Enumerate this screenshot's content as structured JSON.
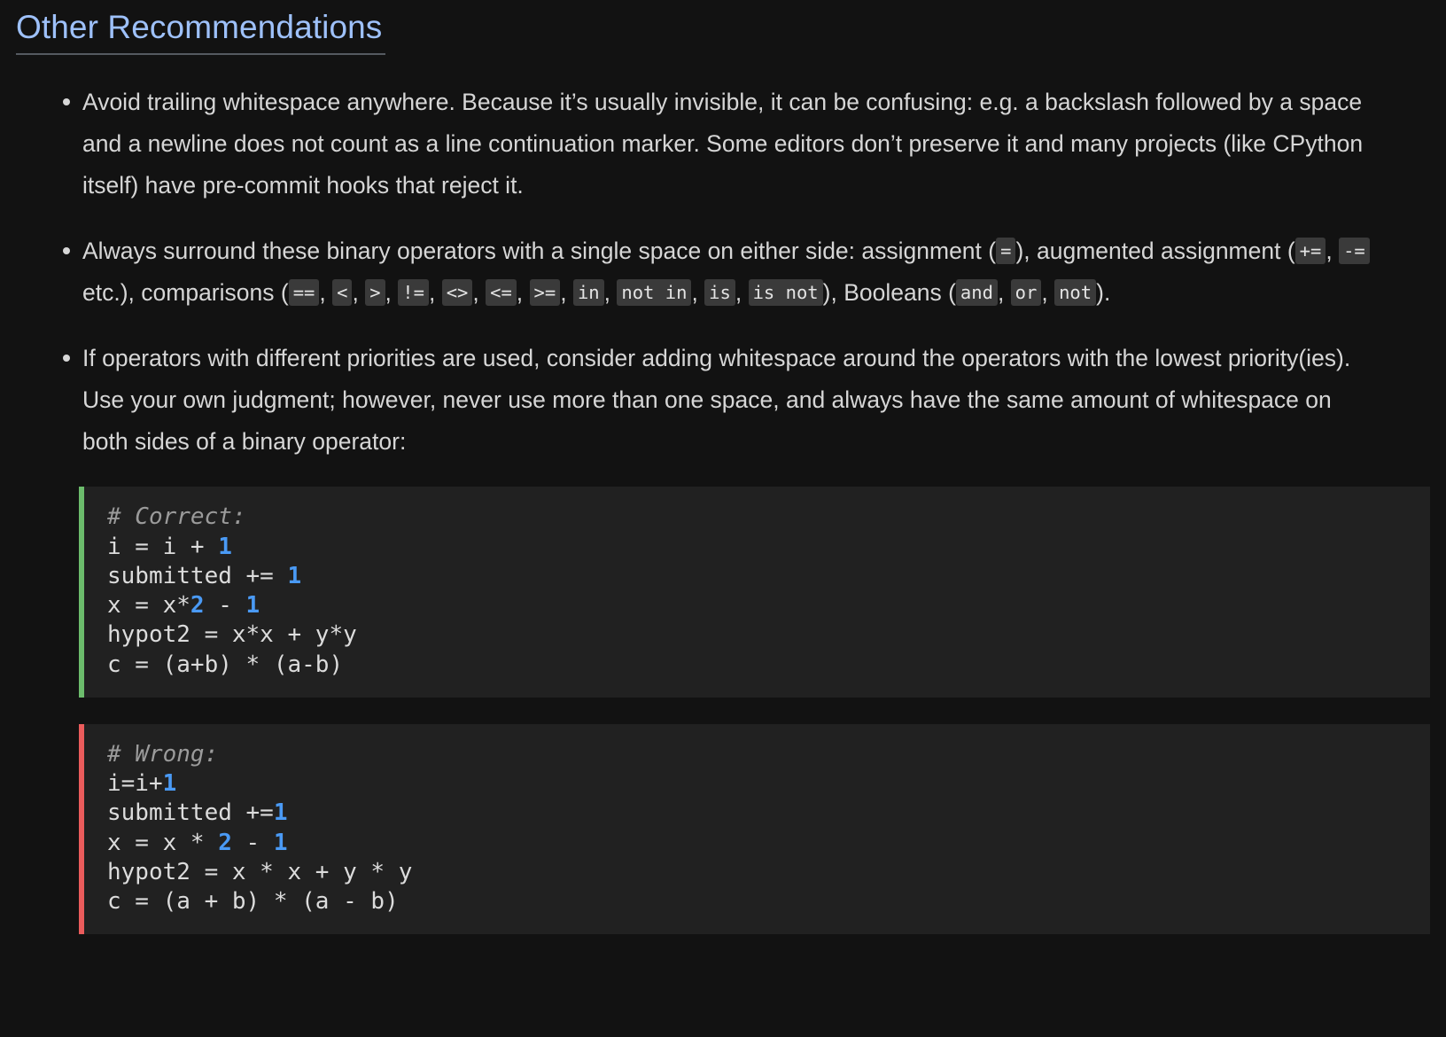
{
  "heading": "Other Recommendations",
  "colors": {
    "page_background": "#121212",
    "heading_link": "#9ec1fa",
    "body_text": "#d6d6d6",
    "code_background": "#212121",
    "inline_code_background": "#3a3a3a",
    "correct_accent": "#6cbc6c",
    "wrong_accent": "#eb5c5c",
    "number_token": "#4a9af5",
    "comment_token": "#9b9b9b"
  },
  "bullets": [
    {
      "id": "trailing-whitespace",
      "parts": [
        {
          "type": "text",
          "value": "Avoid trailing whitespace anywhere. Because it’s usually invisible, it can be confusing: e.g. a backslash followed by a space and a newline does not count as a line continuation marker. Some editors don’t preserve it and many projects (like CPython itself) have pre-commit hooks that reject it."
        }
      ]
    },
    {
      "id": "binary-operator-spacing",
      "parts": [
        {
          "type": "text",
          "value": "Always surround these binary operators with a single space on either side: assignment ("
        },
        {
          "type": "code",
          "value": "="
        },
        {
          "type": "text",
          "value": "), augmented assignment ("
        },
        {
          "type": "code",
          "value": "+="
        },
        {
          "type": "text",
          "value": ", "
        },
        {
          "type": "code",
          "value": "-="
        },
        {
          "type": "text",
          "value": " etc.), comparisons ("
        },
        {
          "type": "code",
          "value": "=="
        },
        {
          "type": "text",
          "value": ", "
        },
        {
          "type": "code",
          "value": "<"
        },
        {
          "type": "text",
          "value": ", "
        },
        {
          "type": "code",
          "value": ">"
        },
        {
          "type": "text",
          "value": ", "
        },
        {
          "type": "code",
          "value": "!="
        },
        {
          "type": "text",
          "value": ", "
        },
        {
          "type": "code",
          "value": "<>"
        },
        {
          "type": "text",
          "value": ", "
        },
        {
          "type": "code",
          "value": "<="
        },
        {
          "type": "text",
          "value": ", "
        },
        {
          "type": "code",
          "value": ">="
        },
        {
          "type": "text",
          "value": ", "
        },
        {
          "type": "code",
          "value": "in"
        },
        {
          "type": "text",
          "value": ", "
        },
        {
          "type": "code",
          "value": "not in"
        },
        {
          "type": "text",
          "value": ", "
        },
        {
          "type": "code",
          "value": "is"
        },
        {
          "type": "text",
          "value": ", "
        },
        {
          "type": "code",
          "value": "is not"
        },
        {
          "type": "text",
          "value": "), Booleans ("
        },
        {
          "type": "code",
          "value": "and"
        },
        {
          "type": "text",
          "value": ", "
        },
        {
          "type": "code",
          "value": "or"
        },
        {
          "type": "text",
          "value": ", "
        },
        {
          "type": "code",
          "value": "not"
        },
        {
          "type": "text",
          "value": ")."
        }
      ]
    },
    {
      "id": "operator-priority-whitespace",
      "parts": [
        {
          "type": "text",
          "value": "If operators with different priorities are used, consider adding whitespace around the operators with the lowest priority(ies). Use your own judgment; however, never use more than one space, and always have the same amount of whitespace on both sides of a binary operator:"
        }
      ]
    }
  ],
  "code_blocks": [
    {
      "id": "correct-example",
      "kind": "correct",
      "accent": "#6cbc6c",
      "lines": [
        [
          {
            "t": "comment",
            "v": "# Correct:"
          }
        ],
        [
          {
            "t": "plain",
            "v": "i = i + "
          },
          {
            "t": "num",
            "v": "1"
          }
        ],
        [
          {
            "t": "plain",
            "v": "submitted += "
          },
          {
            "t": "num",
            "v": "1"
          }
        ],
        [
          {
            "t": "plain",
            "v": "x = x*"
          },
          {
            "t": "num",
            "v": "2"
          },
          {
            "t": "plain",
            "v": " - "
          },
          {
            "t": "num",
            "v": "1"
          }
        ],
        [
          {
            "t": "plain",
            "v": "hypot2 = x*x + y*y"
          }
        ],
        [
          {
            "t": "plain",
            "v": "c = (a+b) * (a-b)"
          }
        ]
      ]
    },
    {
      "id": "wrong-example",
      "kind": "wrong",
      "accent": "#eb5c5c",
      "lines": [
        [
          {
            "t": "comment",
            "v": "# Wrong:"
          }
        ],
        [
          {
            "t": "plain",
            "v": "i=i+"
          },
          {
            "t": "num",
            "v": "1"
          }
        ],
        [
          {
            "t": "plain",
            "v": "submitted +="
          },
          {
            "t": "num",
            "v": "1"
          }
        ],
        [
          {
            "t": "plain",
            "v": "x = x * "
          },
          {
            "t": "num",
            "v": "2"
          },
          {
            "t": "plain",
            "v": " - "
          },
          {
            "t": "num",
            "v": "1"
          }
        ],
        [
          {
            "t": "plain",
            "v": "hypot2 = x * x + y * y"
          }
        ],
        [
          {
            "t": "plain",
            "v": "c = (a + b) * (a - b)"
          }
        ]
      ]
    }
  ]
}
